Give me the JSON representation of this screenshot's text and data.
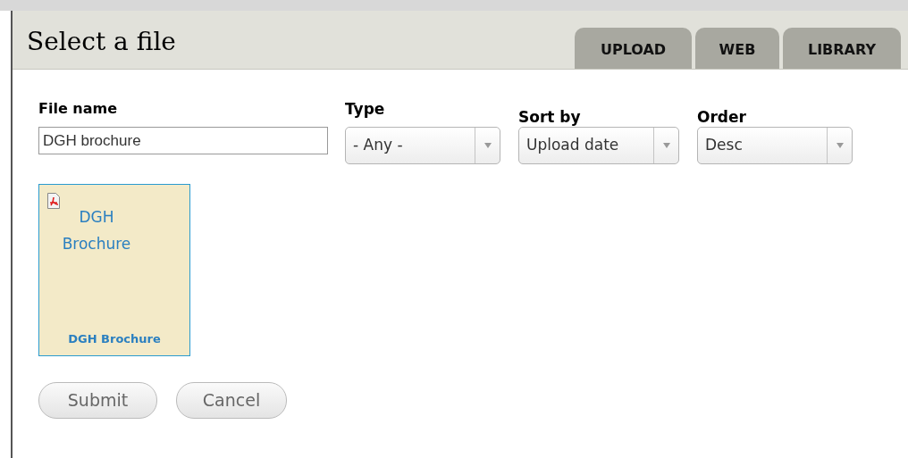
{
  "dialog": {
    "title": "Select a file"
  },
  "tabs": [
    {
      "label": "UPLOAD",
      "selected": false
    },
    {
      "label": "WEB",
      "selected": false
    },
    {
      "label": "LIBRARY",
      "selected": false
    }
  ],
  "filters": {
    "file_name": {
      "label": "File name",
      "value": "DGH brochure"
    },
    "selects": [
      {
        "label": "Type",
        "value": "- Any -"
      },
      {
        "label": "Sort by",
        "value": "Upload date"
      },
      {
        "label": "Order",
        "value": "Desc"
      }
    ]
  },
  "files": [
    {
      "name": "DGH Brochure",
      "caption": "DGH Brochure",
      "selected": true
    }
  ],
  "buttons": [
    "Submit",
    "Cancel"
  ]
}
